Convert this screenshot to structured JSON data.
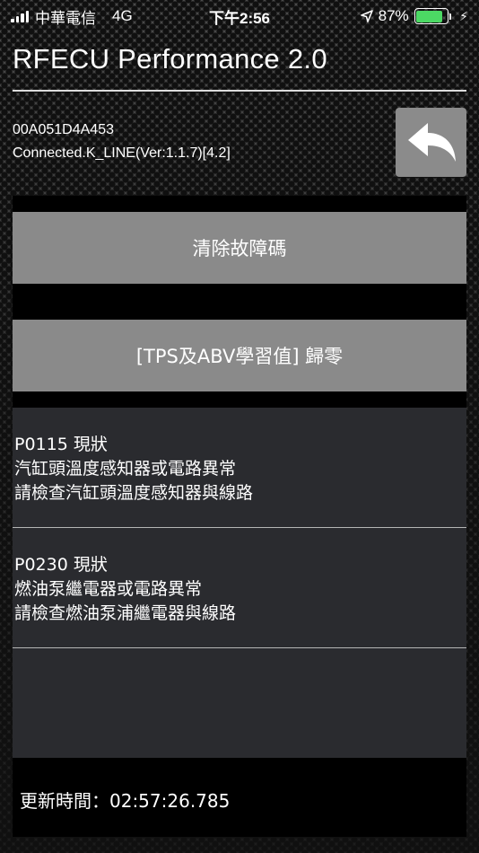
{
  "status_bar": {
    "carrier": "中華電信",
    "network": "4G",
    "time": "下午2:56",
    "battery_percent": "87%",
    "battery_level": 0.87,
    "battery_color": "#4cd964",
    "location_icon": "location-arrow-icon",
    "charging_icon": "bolt-icon"
  },
  "header": {
    "title": "RFECU Performance 2.0"
  },
  "device": {
    "id": "00A051D4A453",
    "connection": "Connected.K_LINE(Ver:1.1.7)[4.2]"
  },
  "back_button": {
    "icon": "back-arrow-icon"
  },
  "actions": {
    "clear_codes": "清除故障碼",
    "reset_learning": "[TPS及ABV學習值] 歸零"
  },
  "fault_codes": [
    {
      "code_status": "P0115 現狀",
      "description": "汽缸頭溫度感知器或電路異常",
      "advice": "請檢查汽缸頭溫度感知器與線路"
    },
    {
      "code_status": "P0230 現狀",
      "description": "燃油泵繼電器或電路異常",
      "advice": "請檢查燃油泵浦繼電器與線路"
    }
  ],
  "footer": {
    "update_time": "更新時間：02:57:26.785"
  },
  "colors": {
    "button_gray": "#8a8a8a",
    "panel_black": "#000000",
    "list_bg": "#2a2b2f"
  }
}
